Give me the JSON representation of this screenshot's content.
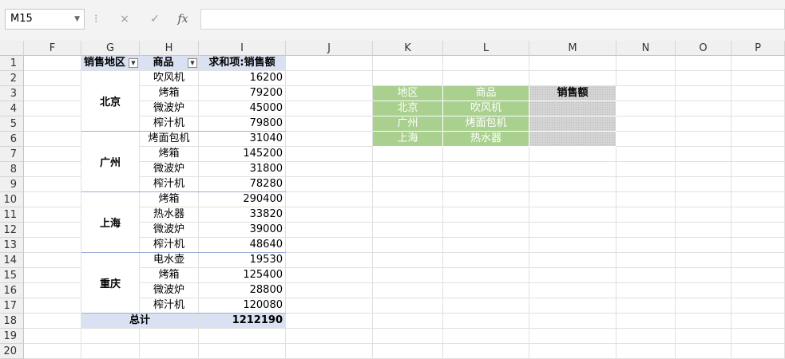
{
  "formula_bar": {
    "name_box": "M15",
    "cancel_icon": "×",
    "enter_icon": "✓",
    "fx_label": "fx",
    "formula": ""
  },
  "columns": [
    "F",
    "G",
    "H",
    "I",
    "J",
    "K",
    "L",
    "M",
    "N",
    "O",
    "P"
  ],
  "rows": [
    "1",
    "2",
    "3",
    "4",
    "5",
    "6",
    "7",
    "8",
    "9",
    "10",
    "11",
    "12",
    "13",
    "14",
    "15",
    "16",
    "17",
    "18",
    "19",
    "20"
  ],
  "pivot": {
    "headers": {
      "region": "销售地区",
      "product": "商品",
      "sum": "求和项:销售额"
    },
    "groups": [
      {
        "region": "北京",
        "items": [
          {
            "product": "吹风机",
            "value": "16200"
          },
          {
            "product": "烤箱",
            "value": "79200"
          },
          {
            "product": "微波炉",
            "value": "45000"
          },
          {
            "product": "榨汁机",
            "value": "79800"
          }
        ]
      },
      {
        "region": "广州",
        "items": [
          {
            "product": "烤面包机",
            "value": "31040"
          },
          {
            "product": "烤箱",
            "value": "145200"
          },
          {
            "product": "微波炉",
            "value": "31800"
          },
          {
            "product": "榨汁机",
            "value": "78280"
          }
        ]
      },
      {
        "region": "上海",
        "items": [
          {
            "product": "烤箱",
            "value": "290400"
          },
          {
            "product": "热水器",
            "value": "33820"
          },
          {
            "product": "微波炉",
            "value": "39000"
          },
          {
            "product": "榨汁机",
            "value": "48640"
          }
        ]
      },
      {
        "region": "重庆",
        "items": [
          {
            "product": "电水壶",
            "value": "19530"
          },
          {
            "product": "烤箱",
            "value": "125400"
          },
          {
            "product": "微波炉",
            "value": "28800"
          },
          {
            "product": "榨汁机",
            "value": "120080"
          }
        ]
      }
    ],
    "total_label": "总计",
    "total_value": "1212190"
  },
  "lookup": {
    "headers": {
      "region": "地区",
      "product": "商品",
      "sales": "销售额"
    },
    "rows": [
      {
        "region": "北京",
        "product": "吹风机",
        "sales": ""
      },
      {
        "region": "广州",
        "product": "烤面包机",
        "sales": ""
      },
      {
        "region": "上海",
        "product": "热水器",
        "sales": ""
      }
    ]
  },
  "colors": {
    "pivot_header": "#d9e1f2",
    "lookup_header": "#a9d08e",
    "selection": "#d4d4d4"
  }
}
